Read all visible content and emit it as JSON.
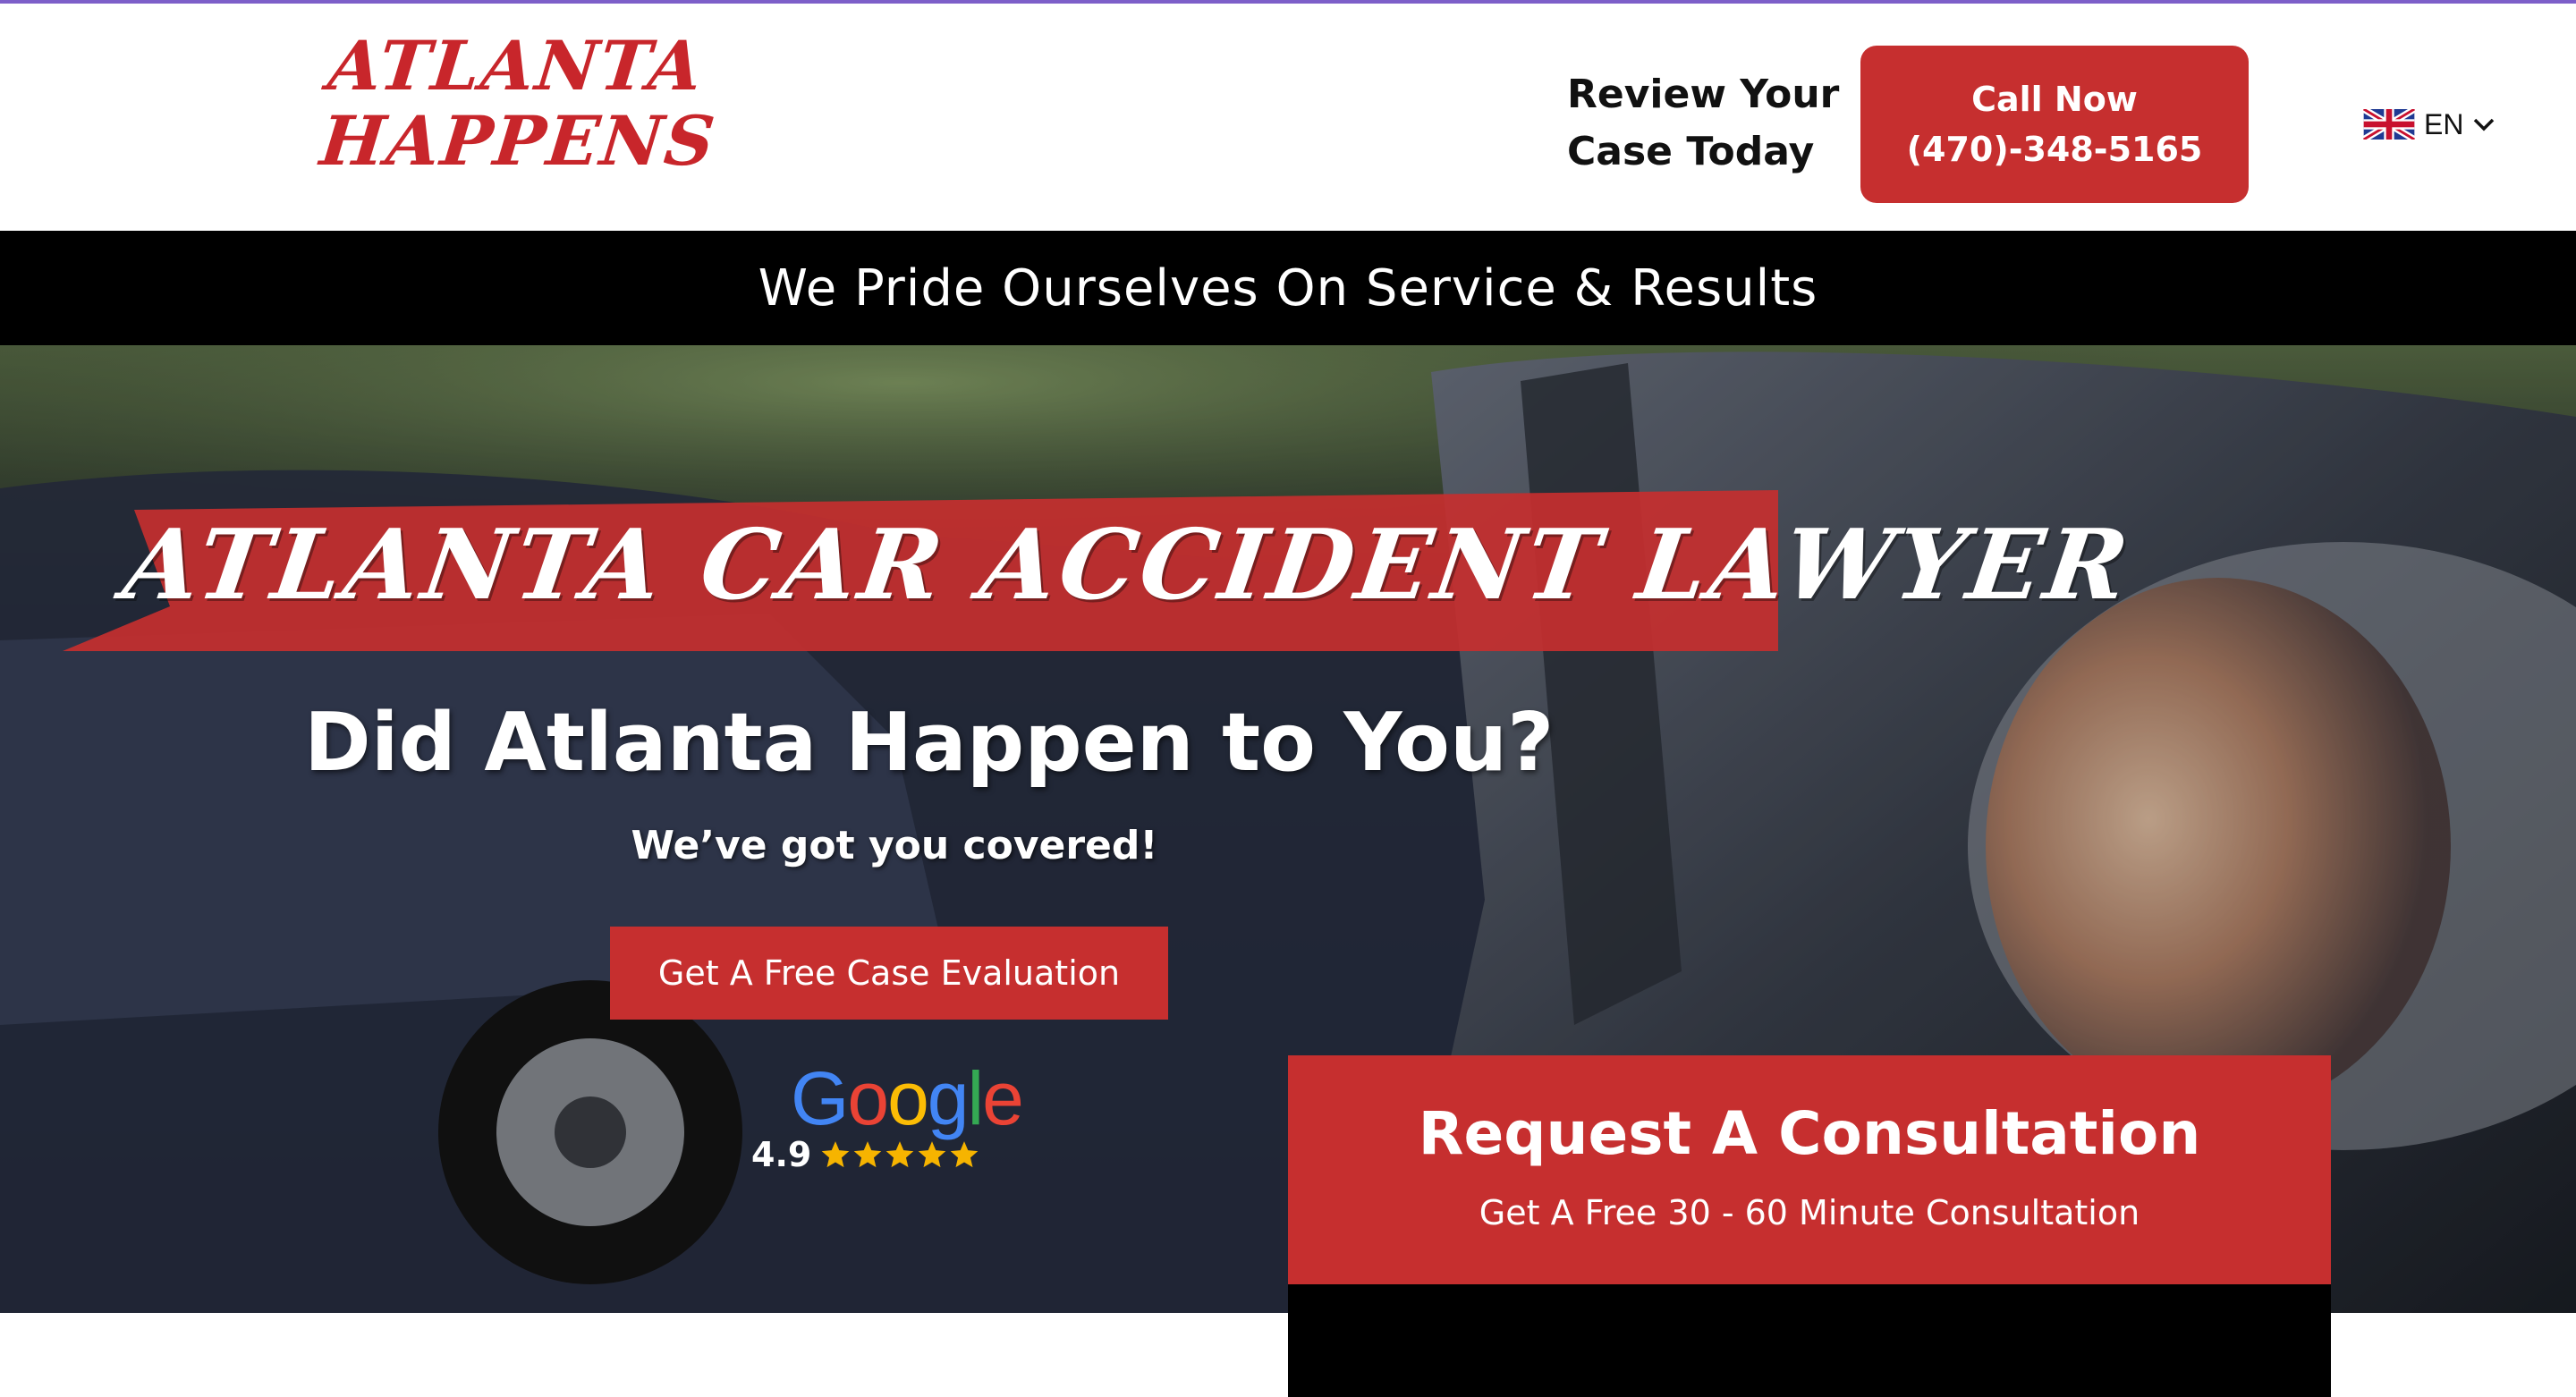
{
  "header": {
    "logo_line1": "ATLANTA",
    "logo_line2": "HAPPENS",
    "review_line1": "Review Your",
    "review_line2": "Case Today",
    "call_label": "Call Now",
    "call_phone": "(470)-348-5165",
    "language": "EN",
    "language_flag_icon": "uk-flag-icon",
    "chevron_icon": "chevron-down-icon"
  },
  "tagline": "We Pride Ourselves On Service & Results",
  "hero": {
    "banner_title": "ATLANTA CAR ACCIDENT LAWYER",
    "heading": "Did Atlanta Happen to You?",
    "subheading": "We’ve got you covered!",
    "cta_label": "Get A Free Case Evaluation"
  },
  "google_rating": {
    "brand_g1": "G",
    "brand_o1": "o",
    "brand_o2": "o",
    "brand_g2": "g",
    "brand_l": "l",
    "brand_e": "e",
    "value": "4.9",
    "stars": 5
  },
  "consultation": {
    "title": "Request A Consultation",
    "subtitle": "Get A Free 30 - 60 Minute Consultation"
  },
  "colors": {
    "accent_red": "#c62f2f",
    "logo_red": "#c8262b",
    "top_accent": "#7d5fc9",
    "star_gold": "#f6b400"
  }
}
